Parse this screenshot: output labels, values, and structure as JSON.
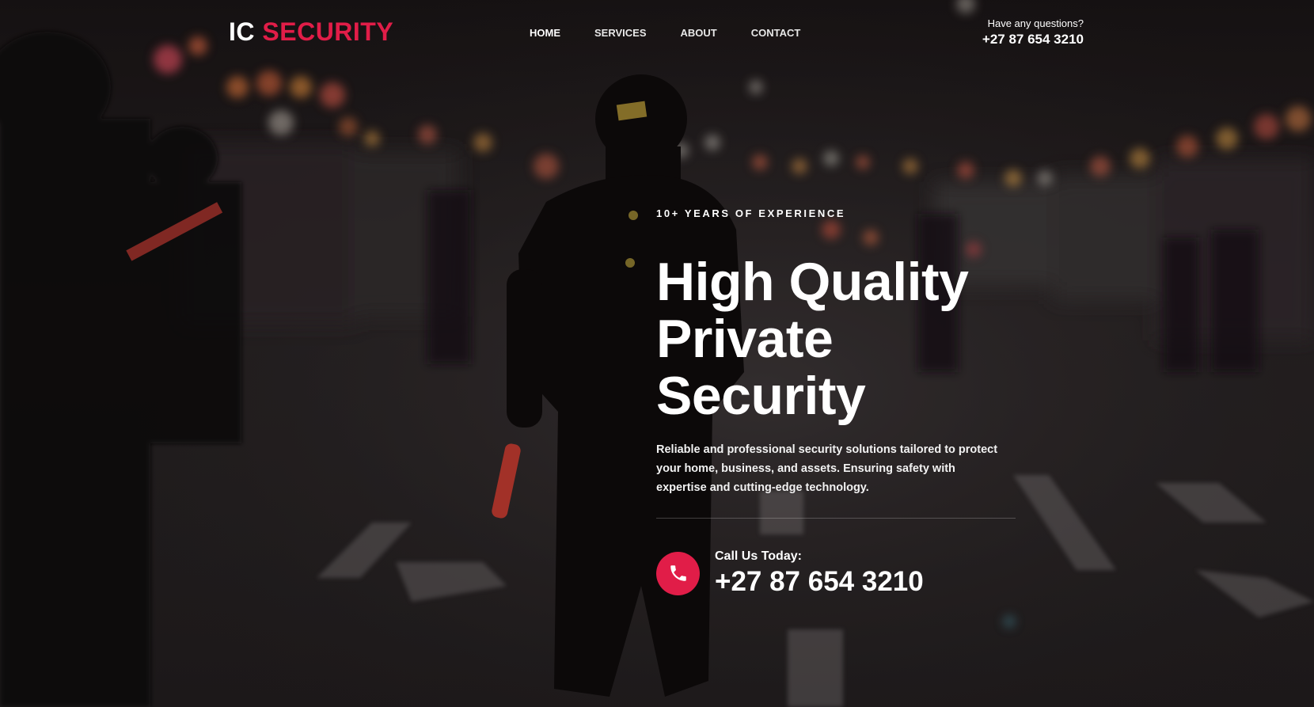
{
  "brand": {
    "part1": "IC",
    "part2": "SECURITY",
    "accent_color": "#e11d48"
  },
  "nav": {
    "items": [
      {
        "label": "HOME",
        "active": true
      },
      {
        "label": "SERVICES",
        "active": false
      },
      {
        "label": "ABOUT",
        "active": false
      },
      {
        "label": "CONTACT",
        "active": false
      }
    ]
  },
  "header_contact": {
    "question": "Have any questions?",
    "phone": "+27 87 654 3210"
  },
  "hero": {
    "eyebrow": "10+ YEARS OF EXPERIENCE",
    "headline": [
      "High Quality",
      "Private",
      "Security"
    ],
    "description": "Reliable and professional security solutions tailored to protect your home, business, and assets. Ensuring safety with expertise and cutting-edge technology.",
    "call_label": "Call Us Today:",
    "call_number": "+27 87 654 3210",
    "call_icon": "phone-icon"
  },
  "background_image": "night-street-security-officer-photo"
}
